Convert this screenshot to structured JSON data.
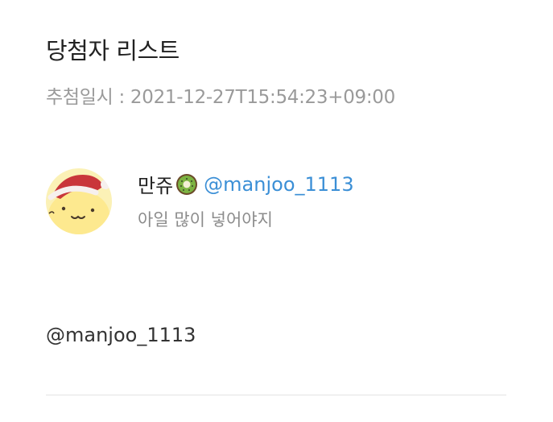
{
  "page": {
    "title": "당첨자 리스트",
    "draw_date": "추첨일시 : 2021-12-27T15:54:23+09:00"
  },
  "winner": {
    "nickname": "만쥬",
    "nickname_icon": "kiwi-emoji",
    "handle": "@manjoo_1113",
    "comment": "아일 많이 넣어야지",
    "avatar_icon": "pompompurin-santa-hat-avatar"
  },
  "winner_list": {
    "handle": "@manjoo_1113"
  },
  "colors": {
    "title": "#222222",
    "muted": "#9a9a9a",
    "link": "#3b8fd6",
    "avatar_bg": "#fbf1b6",
    "hat_red": "#c9363a"
  }
}
